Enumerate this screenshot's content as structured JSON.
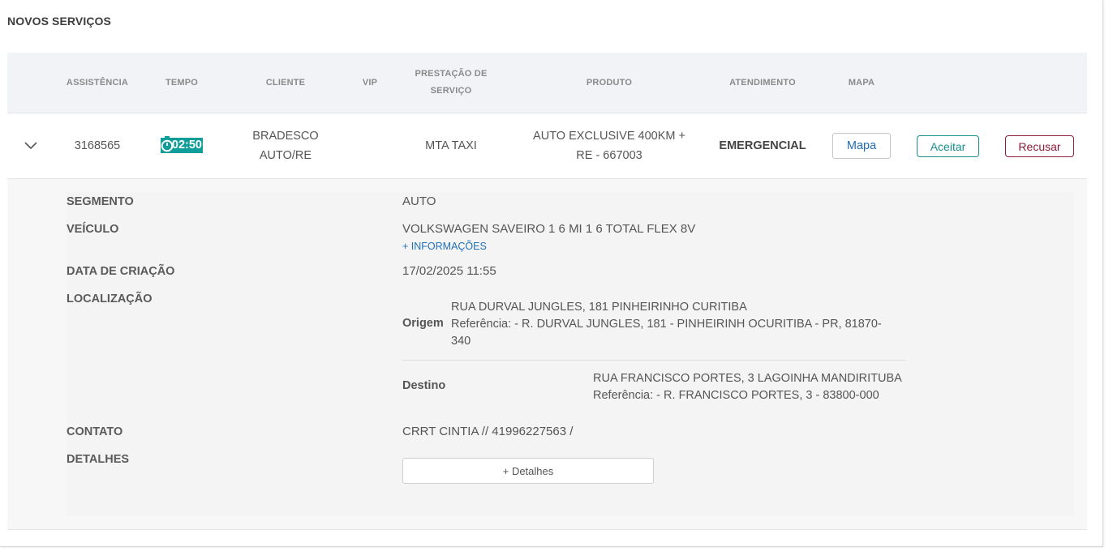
{
  "section": {
    "title": "NOVOS SERVIÇOS"
  },
  "table": {
    "headers": {
      "assistencia": "ASSISTÊNCIA",
      "tempo": "TEMPO",
      "cliente": "CLIENTE",
      "vip": "VIP",
      "prestacao_1": "PRESTAÇÃO DE",
      "prestacao_2": "SERVIÇO",
      "produto": "PRODUTO",
      "atendimento": "ATENDIMENTO",
      "mapa": "MAPA"
    },
    "row": {
      "assistencia": "3168565",
      "tempo": "02:50",
      "cliente_1": "BRADESCO",
      "cliente_2": "AUTO/RE",
      "prestacao": "MTA TAXI",
      "produto_1": "AUTO EXCLUSIVE 400KM +",
      "produto_2": "RE - 667003",
      "atendimento": "EMERGENCIAL",
      "map_button": "Mapa",
      "accept_button": "Aceitar",
      "refuse_button": "Recusar"
    }
  },
  "details": {
    "segmento_label": "SEGMENTO",
    "segmento_value": "AUTO",
    "veiculo_label": "VEÍCULO",
    "veiculo_value": "VOLKSWAGEN SAVEIRO 1 6 MI 1 6 TOTAL FLEX 8V",
    "more_info_link": "+ INFORMAÇÕES",
    "data_label": "DATA DE CRIAÇÃO",
    "data_value": "17/02/2025 11:55",
    "localizacao_label": "LOCALIZAÇÃO",
    "origem": {
      "label": "Origem",
      "address": "RUA DURVAL JUNGLES, 181 PINHEIRINHO CURITIBA",
      "reference_1": "Referência: - R. DURVAL JUNGLES, 181 - PINHEIRINH OCURITIBA - PR, 81870-",
      "reference_2": "340"
    },
    "destino": {
      "label": "Destino",
      "address": "RUA FRANCISCO PORTES, 3 LAGOINHA MANDIRITUBA",
      "reference": "Referência: - R. FRANCISCO PORTES, 3 - 83800-000"
    },
    "contato_label": "CONTATO",
    "contato_value": "CRRT CINTIA // 41996227563 /",
    "detalhes_label": "DETALHES",
    "detalhes_button": "+ Detalhes"
  },
  "colors": {
    "accent_teal": "#0f9d9a",
    "accept": "#168e8c",
    "refuse": "#8b1d3a",
    "link": "#1f6fb9"
  },
  "icons": [
    "chevron-down-icon",
    "stopwatch-icon"
  ]
}
